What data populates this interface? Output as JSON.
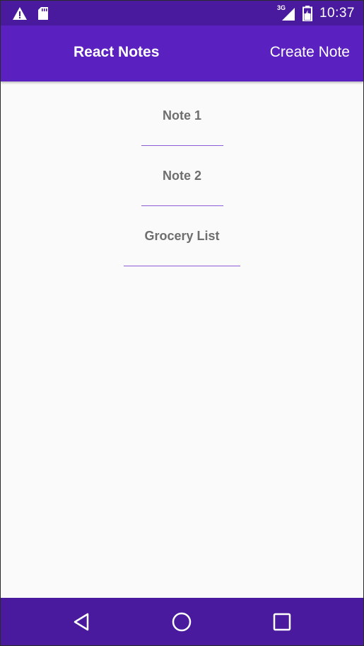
{
  "status_bar": {
    "time": "10:37",
    "network_label": "3G",
    "icons": [
      "warning-icon",
      "sd-card-icon",
      "signal-icon",
      "battery-icon"
    ]
  },
  "app_bar": {
    "title": "React Notes",
    "create_note_label": "Create Note"
  },
  "notes": [
    {
      "title": "Note 1"
    },
    {
      "title": "Note 2"
    },
    {
      "title": "Grocery List"
    }
  ],
  "nav_bar": {
    "buttons": [
      "back-icon",
      "home-icon",
      "recents-icon"
    ]
  },
  "colors": {
    "status_bar": "#4a1a9e",
    "app_bar": "#5b21c0",
    "nav_bar": "#4a1a9e",
    "note_text": "#6e6e6e",
    "underline": "#8a5cd6",
    "background": "#fafafa"
  }
}
